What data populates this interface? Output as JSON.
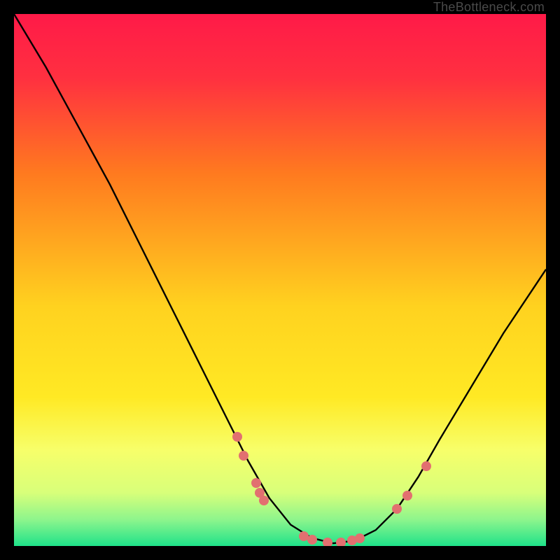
{
  "watermark": "TheBottleneck.com",
  "colors": {
    "bg_black": "#000000",
    "gradient_top": "#ff1a48",
    "gradient_mid1": "#ff7a1f",
    "gradient_mid2": "#ffe924",
    "gradient_mid3": "#f7ff6a",
    "gradient_bottom": "#1fe28a",
    "curve": "#000000",
    "dot": "#e27070",
    "watermark": "#4a4a4a"
  },
  "chart_data": {
    "type": "line",
    "title": "",
    "xlabel": "",
    "ylabel": "",
    "comment": "Bottleneck-style V-curve over a red→yellow→green vertical gradient. Y appears to represent bottleneck severity (0 = optimal at bottom, 1 = worst at top). X axis is an unlabeled continuous parameter spanning [0,1]. Values are visual estimates from the image.",
    "xlim": [
      0,
      1
    ],
    "ylim": [
      0,
      1
    ],
    "curve": {
      "x": [
        0.0,
        0.06,
        0.12,
        0.18,
        0.24,
        0.3,
        0.35,
        0.4,
        0.44,
        0.48,
        0.52,
        0.56,
        0.6,
        0.64,
        0.68,
        0.72,
        0.76,
        0.8,
        0.86,
        0.92,
        1.0
      ],
      "y": [
        1.0,
        0.9,
        0.79,
        0.68,
        0.56,
        0.44,
        0.34,
        0.24,
        0.16,
        0.09,
        0.04,
        0.015,
        0.005,
        0.01,
        0.03,
        0.07,
        0.13,
        0.2,
        0.3,
        0.4,
        0.52
      ]
    },
    "dots": {
      "comment": "Salmon circular markers lying on or near the curve, clustered near the minimum and on the steep left wall.",
      "points": [
        {
          "x": 0.42,
          "y": 0.205
        },
        {
          "x": 0.432,
          "y": 0.17
        },
        {
          "x": 0.455,
          "y": 0.118
        },
        {
          "x": 0.462,
          "y": 0.1
        },
        {
          "x": 0.47,
          "y": 0.085
        },
        {
          "x": 0.545,
          "y": 0.018
        },
        {
          "x": 0.56,
          "y": 0.012
        },
        {
          "x": 0.59,
          "y": 0.007
        },
        {
          "x": 0.615,
          "y": 0.007
        },
        {
          "x": 0.635,
          "y": 0.01
        },
        {
          "x": 0.65,
          "y": 0.015
        },
        {
          "x": 0.72,
          "y": 0.07
        },
        {
          "x": 0.74,
          "y": 0.095
        },
        {
          "x": 0.775,
          "y": 0.15
        }
      ]
    },
    "gradient_stops": [
      {
        "offset": 0.0,
        "hex": "#ff1a48"
      },
      {
        "offset": 0.12,
        "hex": "#ff3040"
      },
      {
        "offset": 0.3,
        "hex": "#ff7a1f"
      },
      {
        "offset": 0.55,
        "hex": "#ffd21f"
      },
      {
        "offset": 0.72,
        "hex": "#ffe924"
      },
      {
        "offset": 0.82,
        "hex": "#f7ff6a"
      },
      {
        "offset": 0.9,
        "hex": "#d8ff7a"
      },
      {
        "offset": 0.95,
        "hex": "#8ef58c"
      },
      {
        "offset": 1.0,
        "hex": "#1fe28a"
      }
    ]
  }
}
